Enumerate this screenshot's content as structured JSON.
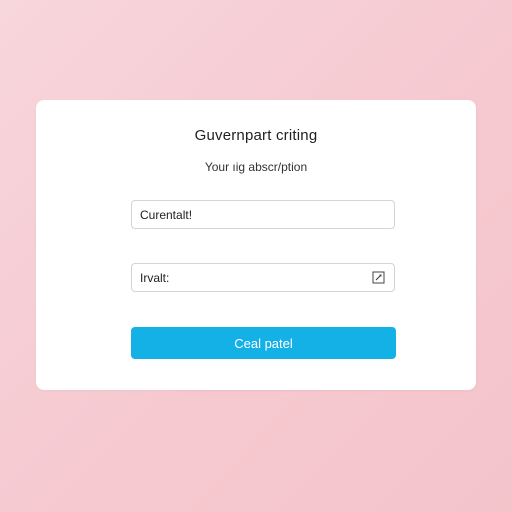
{
  "form": {
    "title": "Guvernpart criting",
    "subtitle": "Your ıig abscr/ption",
    "field_1_value": "Curentalt!",
    "field_2_value": "Irvalt:",
    "field_2_icon": "edit-square-icon",
    "submit_label": "Ceal patel"
  },
  "colors": {
    "background": "#f6ccd3",
    "card": "#ffffff",
    "button": "#14b1e7",
    "button_text": "#ffffff",
    "field_border": "#d4d4d8"
  }
}
